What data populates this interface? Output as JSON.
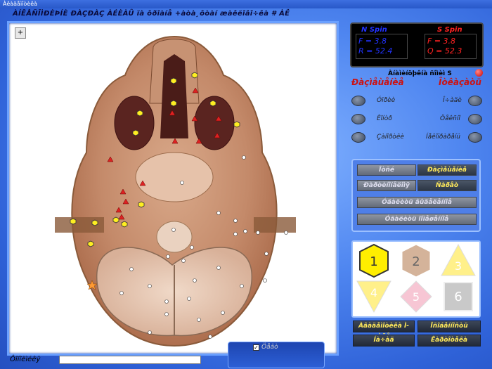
{
  "window": {
    "title": "Àêàäåìîòèêà"
  },
  "menu_line": "ÀÍÊÅÑÎÌÐÈÞÍÈ ÐÀÇÐÀÇ ÀÉÈÀÛ  ïà  ôðîàíå  +àòà¸ôòàí  æàêëîâî÷êà # ÀË",
  "zoom": {
    "icon": "magnifier-plus-icon",
    "label": "+"
  },
  "readout": {
    "left_header": "N  Spin",
    "right_header": "S  Spin",
    "left_rows": [
      {
        "key": "F",
        "value": "3.8"
      },
      {
        "key": "R",
        "value": "52.4"
      }
    ],
    "right_rows": [
      {
        "key": "F",
        "value": "3.8"
      },
      {
        "key": "Q",
        "value": "52.3"
      }
    ]
  },
  "indicator": {
    "label": "Àíàìèíöþêíà ñîìèì S",
    "color": "#cc0000"
  },
  "columns": {
    "left": {
      "title": "Ðàçìåùåíèå",
      "options": [
        "Óïðèè",
        "Êîíòð",
        "Çàíîðòêè"
      ]
    },
    "right": {
      "title": "Îòêàçàòü",
      "options": [
        "Î÷àäè",
        "Öåêñíî",
        "Íåêîïðàðåíü"
      ]
    }
  },
  "buttons": {
    "row1": [
      "Îòñé",
      "Ðàçìåùåíèå"
    ],
    "row2": [
      "Ðàðòèíîíåëîìÿ",
      "Ñàðåò"
    ],
    "row3": "Óäàëèòü âûäåëåííîå",
    "row4": "Óäàëèòü ïîìåøåííîå"
  },
  "shapes": [
    {
      "num": "1",
      "kind": "hexagon",
      "color": "#ffee00",
      "stroke": "#222"
    },
    {
      "num": "2",
      "kind": "hexagon",
      "color": "#d4b39a",
      "stroke": "#ffffff"
    },
    {
      "num": "3",
      "kind": "triangle-up",
      "color": "#fff08a",
      "stroke": "#ffffff"
    },
    {
      "num": "4",
      "kind": "triangle-down",
      "color": "#fff08a",
      "stroke": "#ffffff"
    },
    {
      "num": "5",
      "kind": "diamond",
      "color": "#f7c6d4",
      "stroke": "#ffffff"
    },
    {
      "num": "6",
      "kind": "square",
      "color": "#c9c9c9",
      "stroke": "#ffffff"
    }
  ],
  "bottom_buttons": [
    "Àâàäåìîòèêà Ì-àäå",
    "Îñîáåííîñòü",
    "Íà÷àä",
    "Êàðòîòåêà"
  ],
  "status": {
    "label": "Ôîíîëìéêÿ",
    "value": ""
  },
  "bottom_check": {
    "label": "Öåâò",
    "checked": "✓"
  },
  "markers": {
    "yellow_hex": "#ffee22",
    "red_tri": "#dd2222",
    "white_dot": "#ffffff"
  }
}
